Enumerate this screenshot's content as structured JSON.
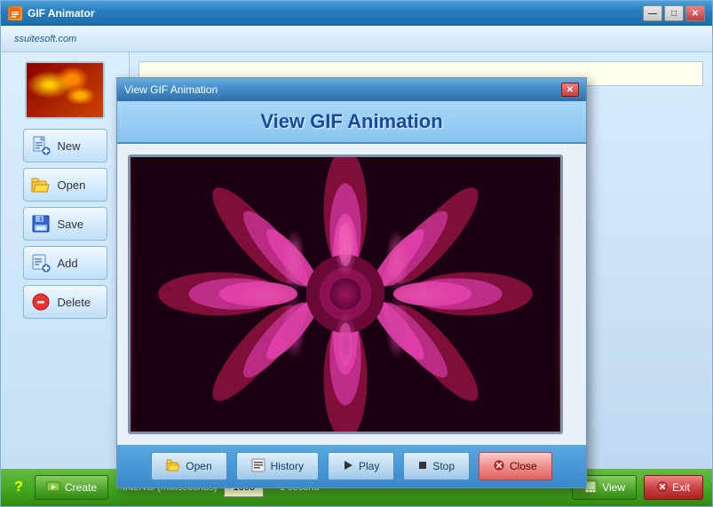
{
  "app": {
    "title": "GIF Animator",
    "brand": "ssuitesoft.com",
    "title_bar_buttons": {
      "minimize": "—",
      "maximize": "□",
      "close": "✕"
    }
  },
  "sidebar": {
    "buttons": [
      {
        "id": "new",
        "label": "New",
        "icon": "new-icon"
      },
      {
        "id": "open",
        "label": "Open",
        "icon": "open-icon"
      },
      {
        "id": "save",
        "label": "Save",
        "icon": "save-icon"
      },
      {
        "id": "add",
        "label": "Add",
        "icon": "add-icon"
      },
      {
        "id": "delete",
        "label": "Delete",
        "icon": "delete-icon"
      }
    ]
  },
  "modal": {
    "title": "View GIF Animation",
    "header": "View GIF Animation",
    "close_symbol": "✕",
    "footer_buttons": [
      {
        "id": "open",
        "label": "Open",
        "icon": "folder-icon"
      },
      {
        "id": "history",
        "label": "History",
        "icon": "history-icon"
      },
      {
        "id": "play",
        "label": "Play",
        "icon": "play-icon"
      },
      {
        "id": "stop",
        "label": "Stop",
        "icon": "stop-icon"
      },
      {
        "id": "close",
        "label": "Close",
        "icon": "close-icon"
      }
    ]
  },
  "bottom_bar": {
    "help": "?",
    "create_label": "Create",
    "create_icon": "create-icon",
    "interval_label": "Interval (milliseconds)",
    "interval_value": "1000",
    "equals_label": "= 1 second",
    "view_label": "View",
    "view_icon": "view-icon",
    "exit_label": "Exit",
    "exit_icon": "exit-icon"
  },
  "colors": {
    "accent": "#2266cc",
    "green_bar": "#44aa22",
    "modal_header": "#4890cc",
    "red": "#cc2222"
  }
}
